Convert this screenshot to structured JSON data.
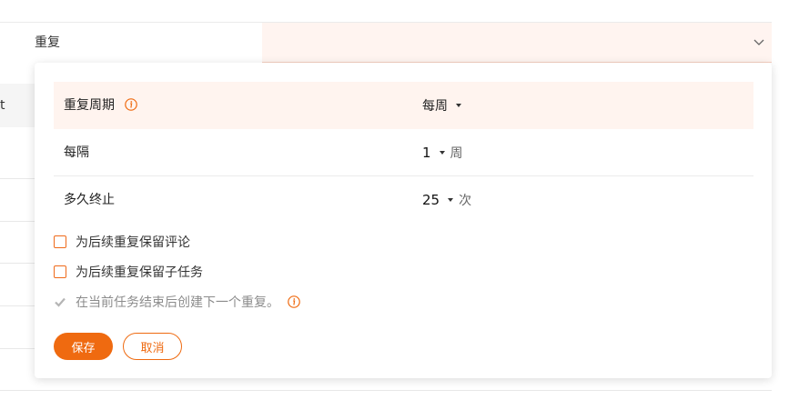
{
  "field": {
    "label": "重复"
  },
  "background": {
    "column_header_partial": "t"
  },
  "popover": {
    "rows": [
      {
        "label": "重复周期",
        "value": "每周"
      },
      {
        "label": "每隔",
        "value": "1",
        "unit": "周"
      },
      {
        "label": "多久终止",
        "value": "25",
        "unit": "次"
      }
    ],
    "checkboxes": [
      {
        "label": "为后续重复保留评论",
        "checked": false
      },
      {
        "label": "为后续重复保留子任务",
        "checked": false
      },
      {
        "label": "在当前任务结束后创建下一个重复。",
        "checked": true,
        "disabled": true
      }
    ],
    "save_label": "保存",
    "cancel_label": "取消"
  },
  "colors": {
    "accent": "#ef6a10",
    "highlight": "#fff4ef"
  }
}
